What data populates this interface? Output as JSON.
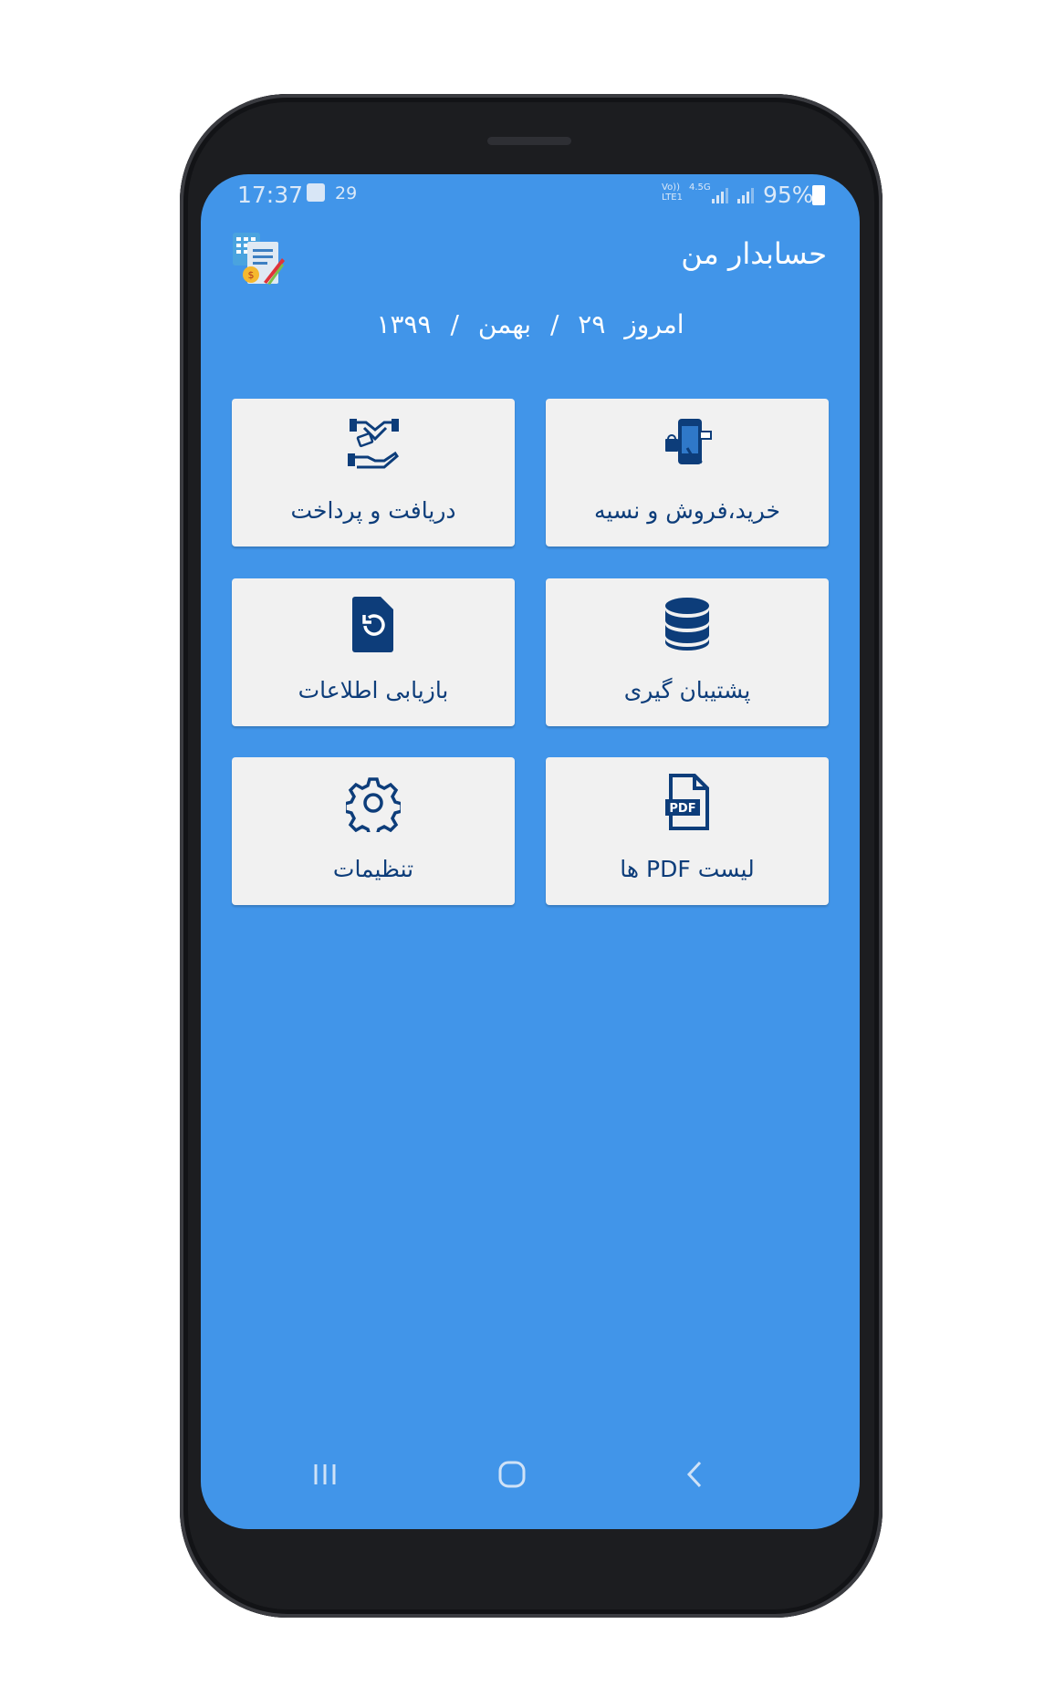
{
  "status_bar": {
    "time": "17:37",
    "notification_count": "29",
    "network_volte": "Vo))",
    "network_lte": "LTE1",
    "network_speed": "4.5G",
    "battery": "95%"
  },
  "header": {
    "title": "حسابدار من",
    "logo_icon": "accounting-app-icon"
  },
  "date": {
    "prefix": "امروز",
    "day": "۲۹",
    "month": "بهمن",
    "year": "۱۳۹۹",
    "separator": "/"
  },
  "menu": [
    {
      "label": "خرید،فروش و نسیه",
      "icon": "shopping-phone-icon"
    },
    {
      "label": "دریافت و پرداخت",
      "icon": "payment-handshake-icon"
    },
    {
      "label": "پشتیبان گیری",
      "icon": "database-icon"
    },
    {
      "label": "بازیابی اطلاعات",
      "icon": "file-restore-icon"
    },
    {
      "label": "لیست PDF ها",
      "icon": "pdf-file-icon"
    },
    {
      "label": "تنظیمات",
      "icon": "gear-icon"
    }
  ],
  "colors": {
    "screen_background": "#4195e9",
    "tile_background": "#f1f1f1",
    "icon_color": "#0d3d7a"
  },
  "nav": {
    "recents_icon": "recent-apps-icon",
    "home_icon": "home-icon",
    "back_icon": "back-icon"
  }
}
